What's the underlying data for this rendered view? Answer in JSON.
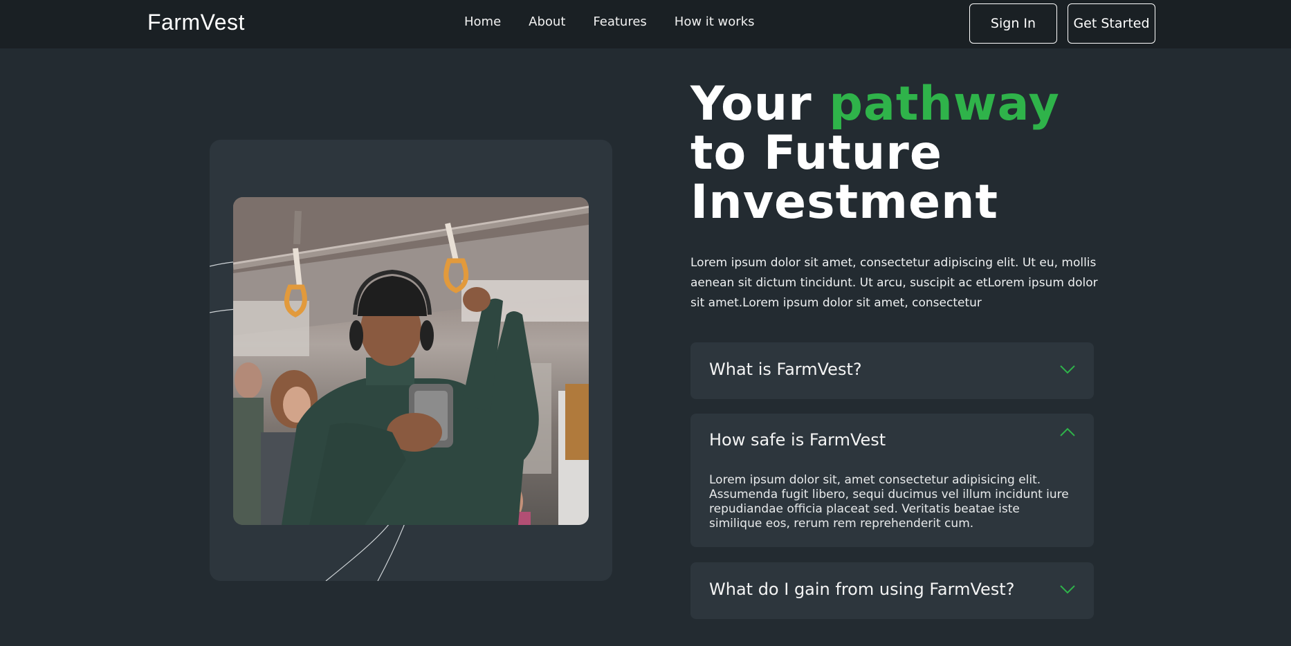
{
  "nav": {
    "logo": "FarmVest",
    "links": [
      "Home",
      "About",
      "Features",
      "How it works"
    ],
    "sign_in": "Sign In",
    "get_started": "Get Started"
  },
  "hero": {
    "headline_before": "Your ",
    "headline_accent": "pathway",
    "headline_after": " to Future Investment",
    "intro": "Lorem ipsum dolor sit amet, consectetur adipiscing elit. Ut eu, mollis aenean sit dictum tincidunt. Ut arcu, suscipit ac etLorem ipsum dolor sit amet.Lorem ipsum dolor sit amet, consectetur"
  },
  "faq": [
    {
      "question": "What is FarmVest?",
      "expanded": false
    },
    {
      "question": "How safe is FarmVest",
      "expanded": true,
      "answer": "Lorem ipsum dolor sit, amet consectetur adipisicing elit. Assumenda fugit libero, sequi ducimus vel illum incidunt iure repudiandae officia placeat sed. Veritatis beatae iste similique eos, rerum rem reprehenderit cum."
    },
    {
      "question": "What do I gain from using FarmVest?",
      "expanded": false
    }
  ],
  "colors": {
    "accent": "#2fb34a",
    "background": "#232b31",
    "nav_background": "#1a2024",
    "card_background": "#2d363d"
  }
}
